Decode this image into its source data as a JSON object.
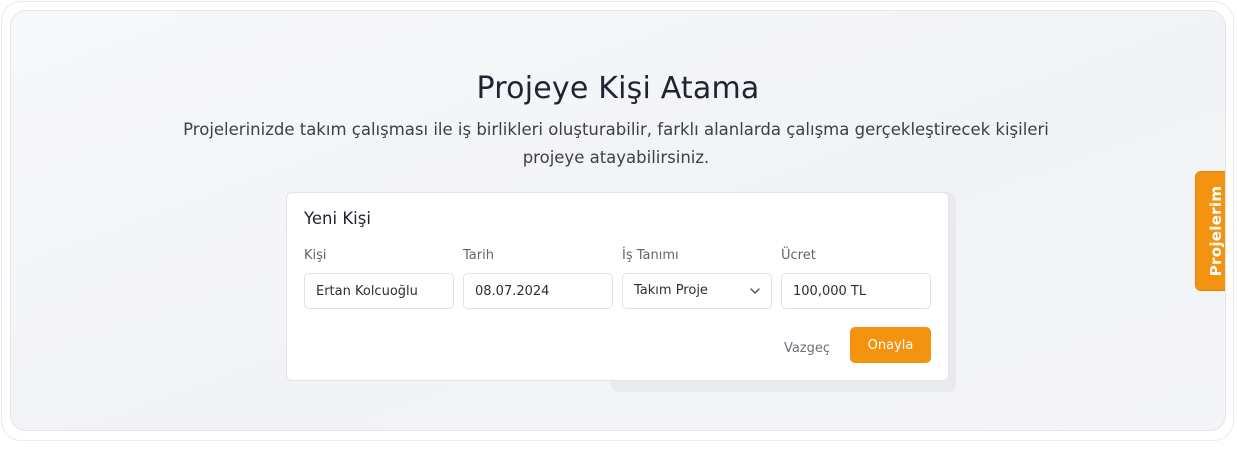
{
  "header": {
    "title": "Projeye Kişi Atama",
    "description": "Projelerinizde takım çalışması ile iş birlikleri oluşturabilir, farklı alanlarda çalışma gerçekleştirecek kişileri projeye atayabilirsiniz."
  },
  "form": {
    "title": "Yeni Kişi",
    "fields": {
      "person": {
        "label": "Kişi",
        "value": "Ertan Kolcuoğlu"
      },
      "date": {
        "label": "Tarih",
        "value": "08.07.2024"
      },
      "job": {
        "label": "İş Tanımı",
        "value": "Takım Proje",
        "icon": "chevron-down-icon"
      },
      "fee": {
        "label": "Ücret",
        "value": "100,000 TL"
      }
    },
    "cancel_label": "Vazgeç",
    "confirm_label": "Onayla"
  },
  "side_tab": {
    "label": "Projelerim"
  },
  "colors": {
    "accent": "#f3930f"
  }
}
